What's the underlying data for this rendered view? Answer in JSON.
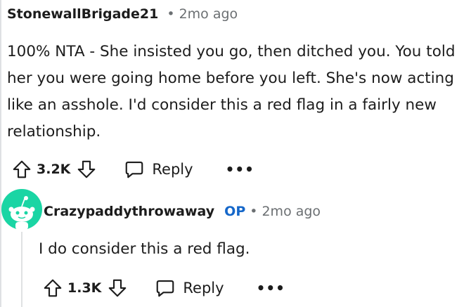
{
  "comment": {
    "username": "StonewallBrigade21",
    "timestamp": "2mo ago",
    "body": "100% NTA - She insisted you go, then ditched you. You told her you were going home before you left. She's now acting like an asshole. I'd consider this a red flag in a fairly new relationship.",
    "score": "3.2K",
    "reply_label": "Reply",
    "more_label": "•••"
  },
  "reply": {
    "username": "Crazypaddythrowaway",
    "op_badge": "OP",
    "timestamp": "2mo ago",
    "body": "I do consider this a red flag.",
    "score": "1.3K",
    "reply_label": "Reply",
    "more_label": "•••",
    "avatar_color": "#1ad5a4"
  },
  "colors": {
    "op_blue": "#1567c9",
    "meta_gray": "#6b6f72",
    "thread_line": "#dfe1e3"
  },
  "icons": [
    "upvote-icon",
    "downvote-icon",
    "comment-icon",
    "more-icon",
    "snoo-avatar-icon"
  ]
}
